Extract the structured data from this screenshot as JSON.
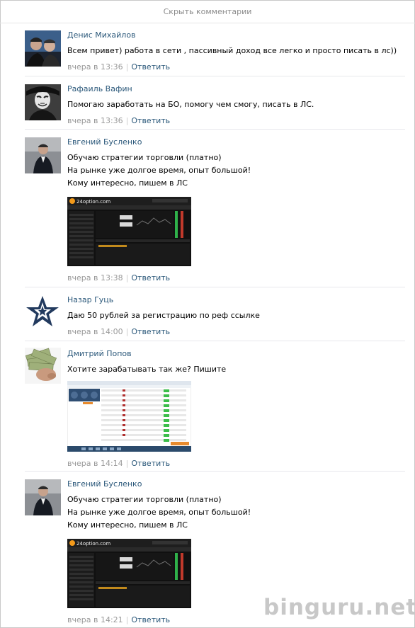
{
  "hide_comments": "Скрыть комментарии",
  "watermark": "binguru.net",
  "comments": [
    {
      "author": "Денис Михайлов",
      "lines": [
        "Всем привет) работа в сети , пассивный доход все легко и просто писать в лс))"
      ],
      "time": "вчера в 13:36",
      "reply": "Ответить"
    },
    {
      "author": "Рафаиль Вафин",
      "lines": [
        "Помогаю заработать на БО, помогу чем смогу, писать в ЛС."
      ],
      "time": "вчера в 13:36",
      "reply": "Ответить"
    },
    {
      "author": "Евгений Бусленко",
      "lines": [
        "Обучаю стратегии торговли (платно)",
        "На рынке уже долгое время, опыт большой!",
        "Кому интересно, пишем в ЛС"
      ],
      "attachment": {
        "logo": "24option.com"
      },
      "time": "вчера в 13:38",
      "reply": "Ответить"
    },
    {
      "author": "Назар Гуць",
      "lines": [
        "Даю 50 рублей за регистрацию по реф ссылке"
      ],
      "time": "вчера в 14:00",
      "reply": "Ответить"
    },
    {
      "author": "Дмитрий Попов",
      "lines": [
        "Хотите зарабатывать так же? Пишите"
      ],
      "time": "вчера в 14:14",
      "reply": "Ответить"
    },
    {
      "author": "Евгений Бусленко",
      "lines": [
        "Обучаю стратегии торговли (платно)",
        "На рынке уже долгое время, опыт большой!",
        "Кому интересно, пишем в ЛС"
      ],
      "attachment": {
        "logo": "24option.com"
      },
      "time": "вчера в 14:21",
      "reply": "Ответить"
    }
  ]
}
